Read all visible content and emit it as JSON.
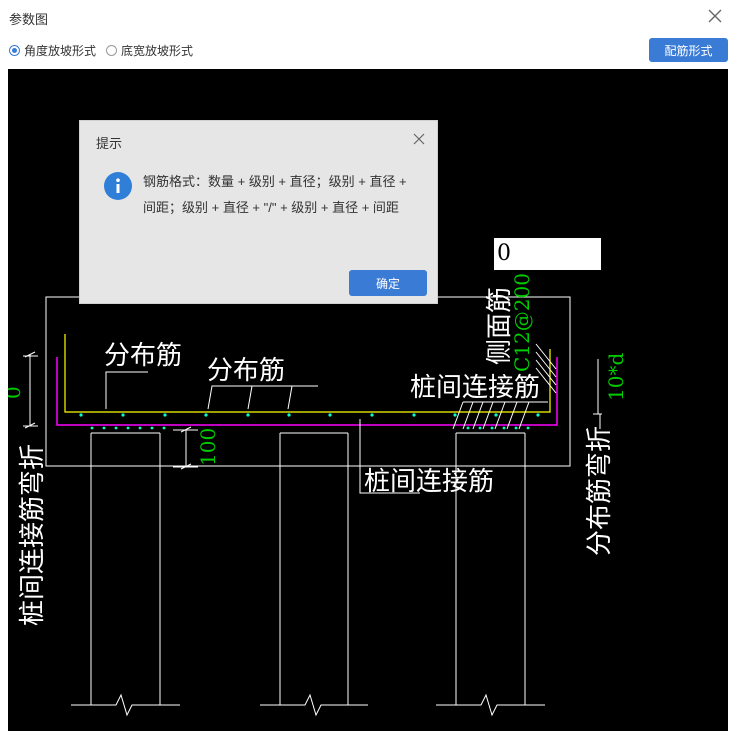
{
  "window": {
    "title": "参数图"
  },
  "options": {
    "radio_angle": "角度放坡形式",
    "radio_width": "底宽放坡形式",
    "config_button": "配筋形式"
  },
  "drawing": {
    "labels": {
      "distrib_1": "分布筋",
      "distrib_2": "分布筋",
      "side_face": "侧面筋",
      "pile_conn_right": "桩间连接筋",
      "pile_conn_bottom": "桩间连接筋",
      "pile_conn_bend": "桩间连接筋弯折",
      "distrib_bend": "分布筋弯折"
    },
    "dims": {
      "left_height": "0",
      "bottom_cover": "100",
      "side_spec": "C12@200",
      "bend_len": "10*d"
    },
    "input_value": "0"
  },
  "dialog": {
    "title": "提示",
    "message": "钢筋格式：数量 + 级别 + 直径；级别 + 直径 + 间距；级别 + 直径 + \"/\" + 级别 + 直径 + 间距",
    "ok_button": "确定"
  },
  "colors": {
    "accent": "#3a7bd5",
    "cad_background": "#000000",
    "cad_white": "#ffffff",
    "cad_yellow": "#ffff00",
    "cad_magenta": "#ff00ff",
    "cad_green": "#00cc00",
    "cad_cyan": "#00ffcc"
  }
}
